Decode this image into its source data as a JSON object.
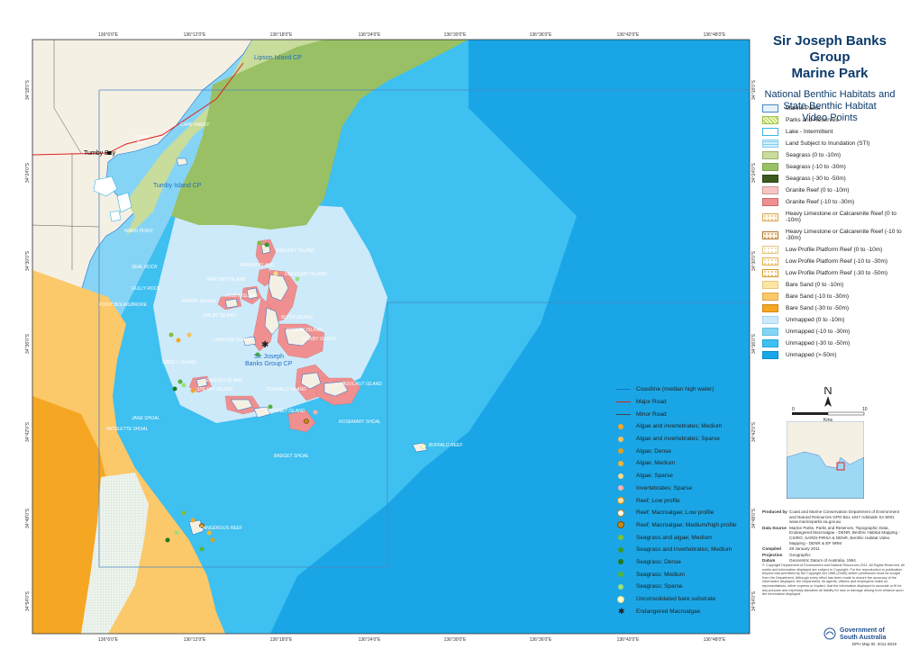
{
  "title": {
    "line1": "Sir Joseph Banks Group",
    "line2": "Marine Park",
    "subtitle1": "National Benthic Habitats and",
    "subtitle2": "State Benthic Habitat",
    "subtitle3": "Video Points"
  },
  "graticule": {
    "lon_top": [
      "136°6'0\"E",
      "136°12'0\"E",
      "136°18'0\"E",
      "136°24'0\"E",
      "136°30'0\"E",
      "136°36'0\"E",
      "136°42'0\"E",
      "136°48'0\"E"
    ],
    "lon_bottom": [
      "136°6'0\"E",
      "136°12'0\"E",
      "136°18'0\"E",
      "136°24'0\"E",
      "136°30'0\"E",
      "136°36'0\"E",
      "136°42'0\"E",
      "136°48'0\"E"
    ],
    "lat": [
      "34°18'0\"S",
      "34°24'0\"S",
      "34°30'0\"S",
      "34°36'0\"S",
      "34°42'0\"S",
      "34°48'0\"S",
      "34°54'0\"S"
    ]
  },
  "places": {
    "lipson": "Lipson Island CP",
    "tumby_bay": "Tumby Bay",
    "tumby_island": "Tumby Island CP",
    "sjb_cp_1": "Sir Joseph",
    "sjb_cp_2": "Banks Group CP"
  },
  "features": {
    "cape_hardy": "CAPE HARDY",
    "tumby_bay_water_1": "TUMBY",
    "tumby_bay_water_2": "BAY",
    "ward_point": "WARD POINT",
    "spilsby": "SPILSBY ISLAND",
    "reevesby": "REEVESBY ISLAND",
    "kirkby": "KIRKBY ISLAND",
    "stickney": "STICKNEY ISLAND",
    "sibsey": "SIBSEY ISLAND",
    "english": "ENGLISH ISLAND",
    "dalby": "DALBY ISLAND",
    "partney": "PARTNEY ISLAND",
    "marum": "MARUM ISLAND",
    "blyth": "BLYTH ISLAND",
    "hareby": "HAREBY ISLAND",
    "roxby": "ROXBY ISLAND",
    "langton": "LANGTON ISLAND",
    "duffield": "DUFFIELD ISLAND",
    "boucaut": "BOUCAUT ISLAND",
    "winceby": "WINCEBY ISLAND",
    "lusby": "LUSBY ISLAND",
    "jane_shoal": "JANE SHOAL",
    "nicolette_shoal": "NICOLETTE SHOAL",
    "rosemary_shoal": "ROSEMARY SHOAL",
    "badger_shoal": "BADGET SHOAL",
    "buffalo_reef": "BUFFALO REEF",
    "dangerous_reef": "DANGEROUS REEF",
    "seal_rock": "SEAL ROCK",
    "gulley_rock": "GULLY ROCK",
    "point_bolingbroke": "POINT BOLINGBROKE",
    "ward_spit": "SPILSBY ISLAND"
  },
  "legend_polygons": [
    {
      "label": "Marine Parks",
      "fill": "#e6f2fb",
      "stroke": "#4a88c2"
    },
    {
      "label": "Parks and Reserves",
      "fill": "#f2f8c8",
      "stroke": "#9fc43a",
      "hatch": true
    },
    {
      "label": "Lake - Intermittent",
      "fill": "#ffffff",
      "stroke": "#3ab5e5"
    },
    {
      "label": "Land Subject to Inundation (STI)",
      "fill": "#d8f0fb",
      "stroke": "#7dcfee",
      "dots": true
    },
    {
      "label": "Seagrass (0 to -10m)",
      "fill": "#c8dc9c",
      "stroke": "#9ab26a"
    },
    {
      "label": "Seagrass (-10 to -30m)",
      "fill": "#99c064",
      "stroke": "#7ea24a"
    },
    {
      "label": "Seagrass (-30 to -50m)",
      "fill": "#3c5a1e",
      "stroke": "#2d4516"
    },
    {
      "label": "Granite Reef (0 to -10m)",
      "fill": "#f6c6c6",
      "stroke": "#d09a9a"
    },
    {
      "label": "Granite Reef (-10 to -30m)",
      "fill": "#ef8f8f",
      "stroke": "#c86c6c"
    },
    {
      "label": "Heavy Limestone or Calcarenite Reef (0 to -10m)",
      "fill": "#fff7e8",
      "stroke": "#d8a95a",
      "pattern": "limestone",
      "two": true
    },
    {
      "label": "Heavy Limestone or Calcarenite Reef (-10 to -30m)",
      "fill": "#fff2dd",
      "stroke": "#b07a3a",
      "pattern": "limestone2",
      "two": true
    },
    {
      "label": "Low Profile Platform Reef (0 to -10m)",
      "fill": "#ffffff",
      "stroke": "#e6c47a",
      "pattern": "lpp1"
    },
    {
      "label": "Low Profile Platform Reef (-10 to -30m)",
      "fill": "#ffffff",
      "stroke": "#e0b04a",
      "pattern": "lpp2"
    },
    {
      "label": "Low Profile Platform Reef (-30 to -50m)",
      "fill": "#ffffff",
      "stroke": "#d89a20",
      "pattern": "lpp3"
    },
    {
      "label": "Bare Sand (0 to -10m)",
      "fill": "#fde7a4",
      "stroke": "#e6c77a"
    },
    {
      "label": "Bare Sand (-10 to -30m)",
      "fill": "#fbc86a",
      "stroke": "#e0a84a"
    },
    {
      "label": "Bare Sand (-30 to -50m)",
      "fill": "#f5a623",
      "stroke": "#d38a10"
    },
    {
      "label": "Unmapped (0 to -10m)",
      "fill": "#cdeafa",
      "stroke": "#9fd4f0"
    },
    {
      "label": "Unmapped (-10 to -30m)",
      "fill": "#86d4f5",
      "stroke": "#5fc0ea"
    },
    {
      "label": "Unmapped (-30 to -50m)",
      "fill": "#3ec0f0",
      "stroke": "#22a8dc"
    },
    {
      "label": "Unmapped (>-50m)",
      "fill": "#1aa6e6",
      "stroke": "#0b8ccc"
    }
  ],
  "legend_lines": [
    {
      "label": "Coastline (median high water)",
      "color": "#1a6fd0",
      "width": 1
    },
    {
      "label": "Major Road",
      "color": "#d22",
      "width": 1
    },
    {
      "label": "Minor Road",
      "color": "#444",
      "width": 0.8
    }
  ],
  "legend_points": [
    {
      "label": "Algae and invertebrates; Medium",
      "color": "#f5a623",
      "ring": ""
    },
    {
      "label": "Algae and invertebrates; Sparse",
      "color": "#f8c05a",
      "ring": ""
    },
    {
      "label": "Algae; Dense",
      "color": "#e0a020",
      "ring": ""
    },
    {
      "label": "Algae; Medium",
      "color": "#f2b630",
      "ring": ""
    },
    {
      "label": "Algae; Sparse",
      "color": "#f8d98a",
      "ring": ""
    },
    {
      "label": "Invertebrates; Sparse",
      "color": "#f6b0b0",
      "ring": ""
    },
    {
      "label": "Reef; Low profile",
      "color": "#fde0a0",
      "ring": "#e08a00"
    },
    {
      "label": "Reef; Macroalgae; Low profile",
      "color": "#ffffff",
      "ring": "#c07a00"
    },
    {
      "label": "Reef; Macroalgae; Medium/high profile",
      "color": "#c88a1a",
      "ring": "#7a4a00"
    },
    {
      "label": "Seagrass and algae; Medium",
      "color": "#7fbf3a",
      "ring": ""
    },
    {
      "label": "Seagrass and invertebrates; Medium",
      "color": "#3a9a2a",
      "ring": ""
    },
    {
      "label": "Seagrass; Dense",
      "color": "#1f7a1f",
      "ring": ""
    },
    {
      "label": "Seagrass; Medium",
      "color": "#52b43a",
      "ring": ""
    },
    {
      "label": "Seagrass; Sparse",
      "color": "#9be07a",
      "ring": ""
    },
    {
      "label": "Unconsolidated bare substrate",
      "color": "#ffffd0",
      "ring": "#d8d08a"
    },
    {
      "label": "Endangered Macroalgae",
      "color": "#222222",
      "ring": "",
      "star": true
    }
  ],
  "north": "N",
  "scale": {
    "left": "0",
    "right": "10",
    "unit": "Kms"
  },
  "metadata": {
    "produced_by_key": "Produced by",
    "produced_by": "Coast and Marine Conservation Department of Environment and Natural Resources GPO Box 1047 Adelaide SA 5001 www.marineparks.sa.gov.au",
    "data_source_key": "Data Source",
    "data_source": "Marine Parks, Parks and Reserves, Topographic Data, Endangered Macroalgae - DENR, Benthic Habitat Mapping - CSIRO, SARDI-PIRSA & DENR, Benthic Habitat Video Mapping - DENR & EP NRM",
    "compiled_key": "Compiled",
    "compiled": "28 January 2011",
    "projection_key": "Projection",
    "projection": "Geographic",
    "datum_key": "Datum",
    "datum": "Geocentric Datum of Australia, 1994"
  },
  "copyright": "© Copyright Department of Environment and Natural Resources 2011. All Rights Reserved. All works and information displayed are subject to Copyright. For the reproduction or publication beyond that permitted by the Copyright Act 1968 (Cwlth) written permission must be sought from the Department. Although every effort has been made to ensure the accuracy of the information displayed, the Department, its agents, officers and employees make no representations, either express or implied, that the information displayed is accurate or fit for any purpose and expressly disclaims all liability for loss or damage arising from reliance upon the information displayed.",
  "government": {
    "line1": "Government of",
    "line2": "South Australia"
  },
  "map_id": "DPH Map ID: 2011-4819"
}
